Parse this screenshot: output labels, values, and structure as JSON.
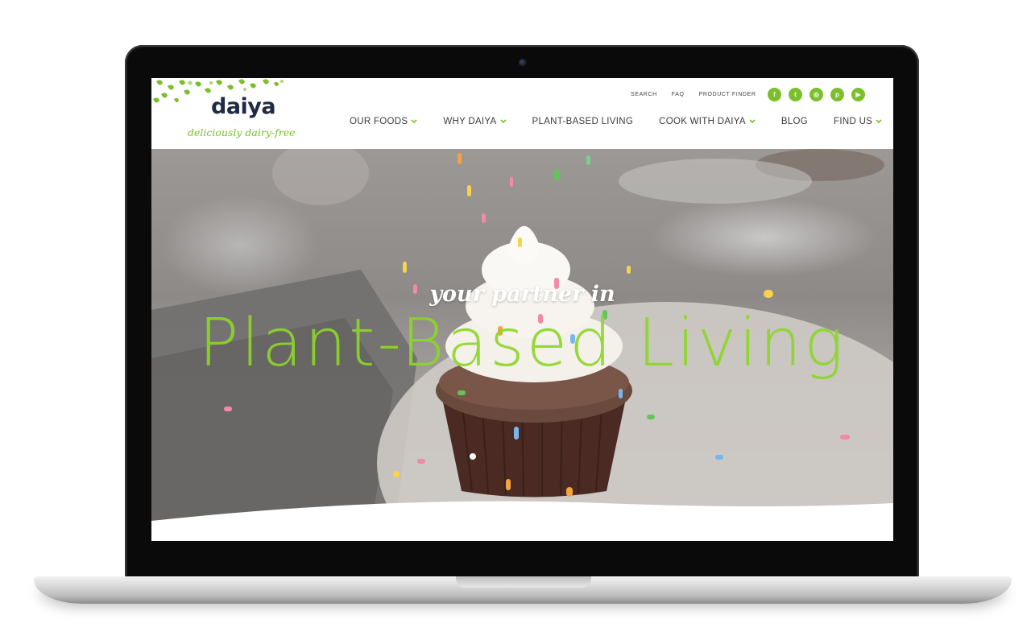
{
  "brand": {
    "logo_text": "daiya",
    "tagline": "deliciously dairy-free",
    "accent_color": "#7bbf2a"
  },
  "utility_nav": [
    "SEARCH",
    "FAQ",
    "PRODUCT FINDER"
  ],
  "social": [
    {
      "icon": "facebook-icon",
      "glyph": "f"
    },
    {
      "icon": "twitter-icon",
      "glyph": "t"
    },
    {
      "icon": "instagram-icon",
      "glyph": "◎"
    },
    {
      "icon": "pinterest-icon",
      "glyph": "p"
    },
    {
      "icon": "youtube-icon",
      "glyph": "▶"
    }
  ],
  "main_nav": [
    {
      "label": "OUR FOODS",
      "has_dropdown": true
    },
    {
      "label": "WHY DAIYA",
      "has_dropdown": true
    },
    {
      "label": "PLANT-BASED LIVING",
      "has_dropdown": false
    },
    {
      "label": "COOK WITH DAIYA",
      "has_dropdown": true
    },
    {
      "label": "BLOG",
      "has_dropdown": false
    },
    {
      "label": "FIND US",
      "has_dropdown": true
    }
  ],
  "hero": {
    "subtitle": "your partner in",
    "title": "Plant-Based Living"
  }
}
